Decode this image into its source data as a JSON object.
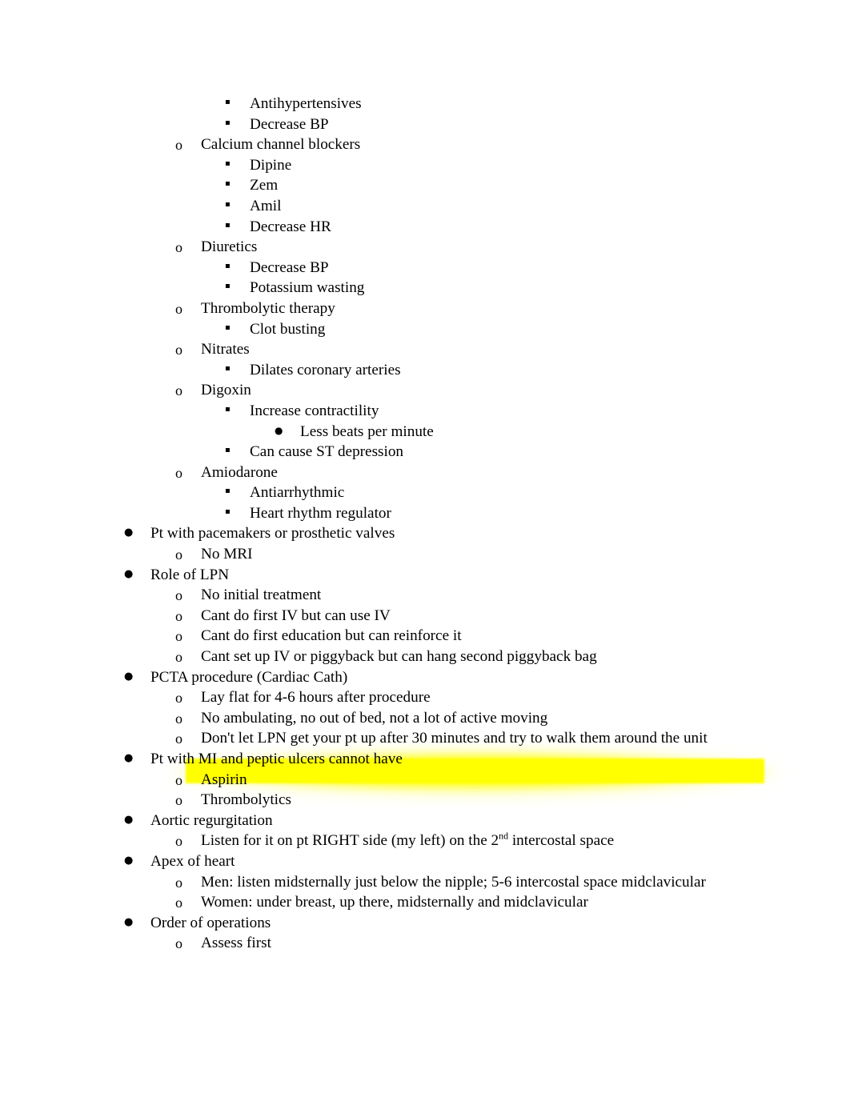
{
  "document": {
    "page_background": "#ffffff",
    "text_color": "#000000",
    "highlight_color": "#ffff00"
  },
  "markers": {
    "level1": "●",
    "level2": "o",
    "level3": "▪",
    "level4": "●"
  },
  "outline": [
    {
      "level": 3,
      "text": "Antihypertensives",
      "highlighted": false
    },
    {
      "level": 3,
      "text": "Decrease BP",
      "highlighted": false
    },
    {
      "level": 2,
      "text": "Calcium channel blockers",
      "highlighted": false
    },
    {
      "level": 3,
      "text": "Dipine",
      "highlighted": false
    },
    {
      "level": 3,
      "text": "Zem",
      "highlighted": false
    },
    {
      "level": 3,
      "text": "Amil",
      "highlighted": false
    },
    {
      "level": 3,
      "text": "Decrease HR",
      "highlighted": false
    },
    {
      "level": 2,
      "text": "Diuretics",
      "highlighted": false
    },
    {
      "level": 3,
      "text": "Decrease BP",
      "highlighted": false
    },
    {
      "level": 3,
      "text": "Potassium wasting",
      "highlighted": false
    },
    {
      "level": 2,
      "text": "Thrombolytic therapy",
      "highlighted": false
    },
    {
      "level": 3,
      "text": "Clot busting",
      "highlighted": false
    },
    {
      "level": 2,
      "text": "Nitrates",
      "highlighted": false
    },
    {
      "level": 3,
      "text": "Dilates coronary arteries",
      "highlighted": false
    },
    {
      "level": 2,
      "text": "Digoxin",
      "highlighted": false
    },
    {
      "level": 3,
      "text": "Increase contractility",
      "highlighted": false
    },
    {
      "level": 4,
      "text": "Less beats per minute",
      "highlighted": false
    },
    {
      "level": 3,
      "text": "Can cause ST depression",
      "highlighted": false
    },
    {
      "level": 2,
      "text": "Amiodarone",
      "highlighted": false
    },
    {
      "level": 3,
      "text": "Antiarrhythmic",
      "highlighted": false
    },
    {
      "level": 3,
      "text": "Heart rhythm regulator",
      "highlighted": false
    },
    {
      "level": 1,
      "text": "Pt with pacemakers or prosthetic valves",
      "highlighted": false
    },
    {
      "level": 2,
      "text": "No MRI",
      "highlighted": false
    },
    {
      "level": 1,
      "text": "Role of LPN",
      "highlighted": false
    },
    {
      "level": 2,
      "text": "No initial treatment",
      "highlighted": false
    },
    {
      "level": 2,
      "text": "Cant do first IV but can use IV",
      "highlighted": false
    },
    {
      "level": 2,
      "text": "Cant do first education but can reinforce it",
      "highlighted": false
    },
    {
      "level": 2,
      "text": "Cant set up IV or piggyback but can hang second piggyback bag",
      "highlighted": false
    },
    {
      "level": 1,
      "text": "PCTA procedure (Cardiac Cath)",
      "highlighted": false
    },
    {
      "level": 2,
      "text": "Lay flat for 4-6 hours after procedure",
      "highlighted": false
    },
    {
      "level": 2,
      "text": "No ambulating, no out of bed, not a lot of active moving",
      "highlighted": false
    },
    {
      "level": 2,
      "text": "Don't let LPN get your pt up after 30 minutes and try to walk them around the unit",
      "highlighted": true
    },
    {
      "level": 1,
      "text": "Pt with MI and peptic ulcers cannot have",
      "highlighted": false
    },
    {
      "level": 2,
      "text": "Aspirin",
      "highlighted": false
    },
    {
      "level": 2,
      "text": "Thrombolytics",
      "highlighted": false
    },
    {
      "level": 1,
      "text": "Aortic regurgitation",
      "highlighted": false
    },
    {
      "level": 2,
      "text": "Listen for it on pt RIGHT side (my left) on the 2",
      "superscript": "nd",
      "text_after": " intercostal space",
      "highlighted": false
    },
    {
      "level": 1,
      "text": "Apex of heart",
      "highlighted": false
    },
    {
      "level": 2,
      "text": "Men: listen midsternally just below the nipple; 5-6 intercostal space midclavicular",
      "highlighted": false
    },
    {
      "level": 2,
      "text": "Women: under breast, up there, midsternally and midclavicular",
      "highlighted": false
    },
    {
      "level": 1,
      "text": "Order of operations",
      "highlighted": false
    },
    {
      "level": 2,
      "text": "Assess first",
      "highlighted": false
    }
  ]
}
